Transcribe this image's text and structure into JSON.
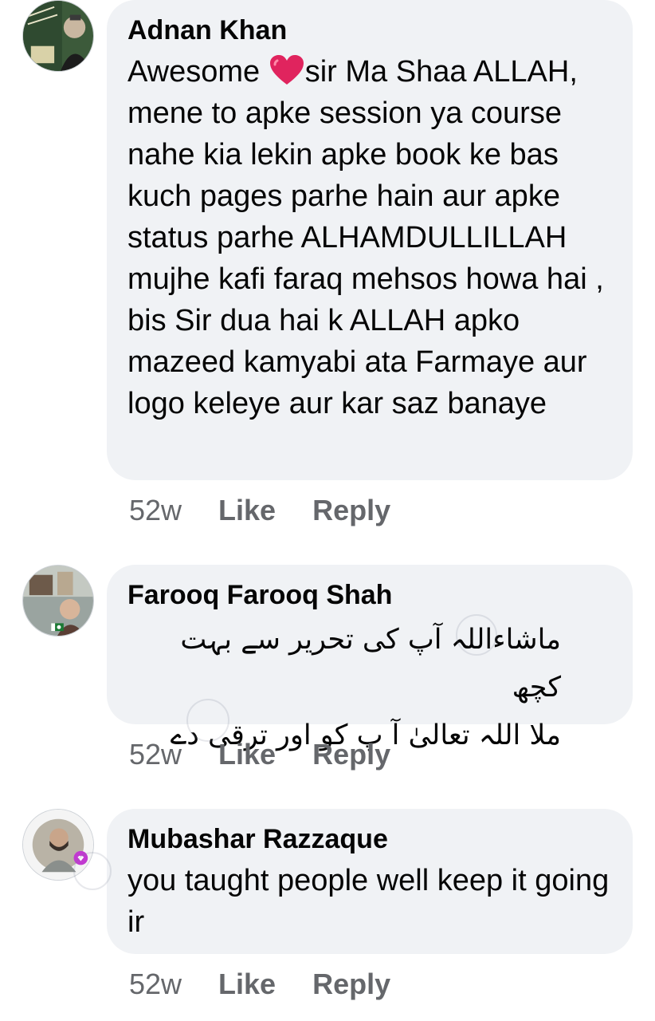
{
  "comments": [
    {
      "author": "Adnan Khan",
      "text_before_emoji": "Awesome ",
      "emoji": "heart-icon",
      "text_after_emoji": "sir Ma Shaa ALLAH, mene to apke session ya course nahe kia lekin apke book ke bas kuch pages parhe hain aur apke status parhe ALHAMDULLILLAH mujhe kafi faraq mehsos howa hai , bis Sir dua hai k ALLAH apko mazeed kamyabi ata Farmaye aur logo keleye aur kar saz banaye",
      "time": "52w",
      "like_label": "Like",
      "reply_label": "Reply",
      "avatar_icon": "profile-photo"
    },
    {
      "author": "Farooq Farooq Shah",
      "text_line1": "ماشاءاللہ آپ کی تحریر سے بہت کچھ",
      "text_line2": "ملا اللہ تعالیٰ آ پ کو اور ترقی دے",
      "time": "52w",
      "like_label": "Like",
      "reply_label": "Reply",
      "avatar_icon": "profile-photo"
    },
    {
      "author": "Mubashar Razzaque",
      "text": "you taught  people  well keep it going ir",
      "time": "52w",
      "like_label": "Like",
      "reply_label": "Reply",
      "avatar_icon": "profile-photo"
    }
  ],
  "colors": {
    "bubble": "#f0f2f5",
    "meta_text": "#65676b",
    "primary_text": "#050505",
    "heart": "#e0245e"
  }
}
